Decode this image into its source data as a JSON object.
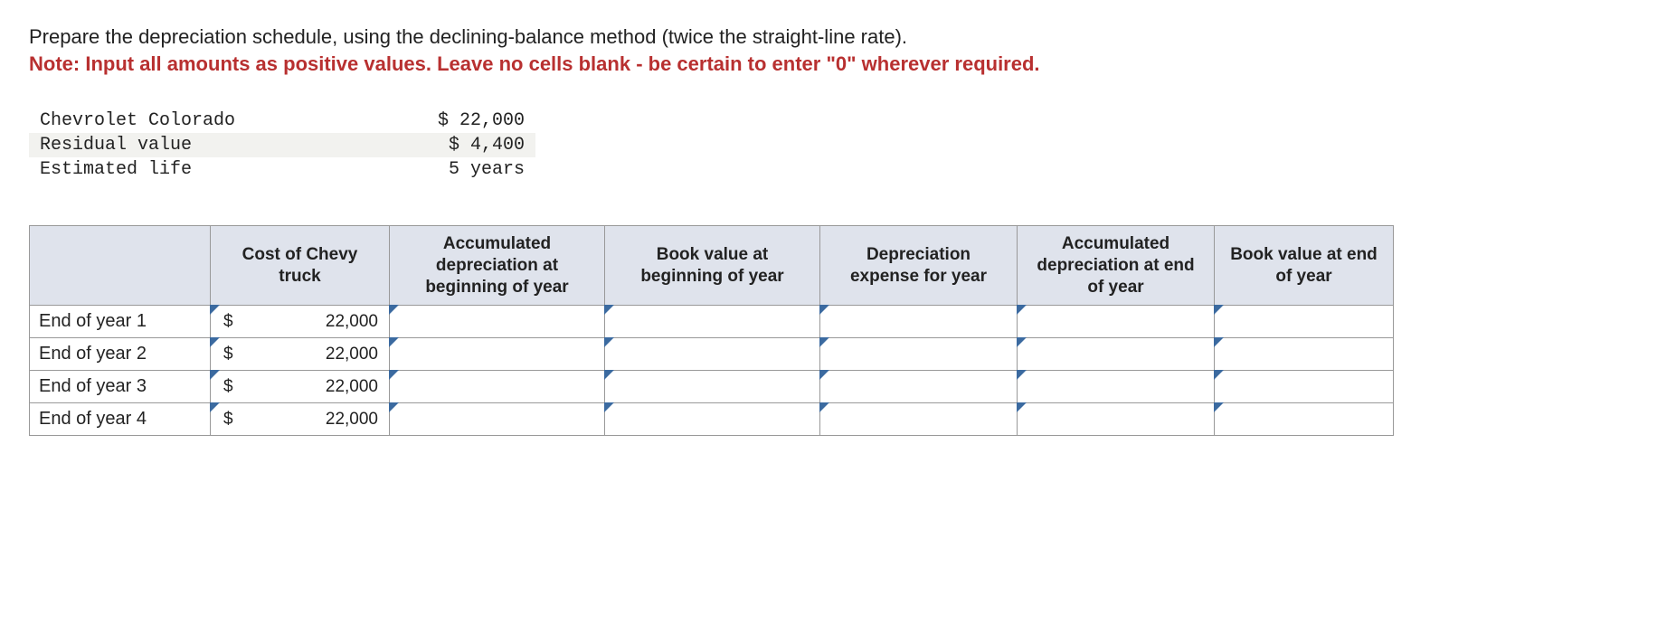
{
  "prompt": {
    "line1": "Prepare the depreciation schedule, using the declining-balance method (twice the straight-line rate).",
    "line2": "Note: Input all amounts as positive values. Leave no cells blank - be certain to enter \"0\" wherever required."
  },
  "given": {
    "asset_label": "Chevrolet Colorado",
    "asset_value": "$ 22,000",
    "residual_label": "Residual value",
    "residual_value": "$ 4,400",
    "life_label": "Estimated life",
    "life_value": "5 years"
  },
  "table": {
    "headers": {
      "blank": "",
      "cost": "Cost of Chevy truck",
      "acc_begin": "Accumulated depreciation at beginning of year",
      "bv_begin": "Book value at beginning of year",
      "dep_exp": "Depreciation expense for year",
      "acc_end": "Accumulated depreciation at end of year",
      "bv_end": "Book value at end of year"
    },
    "rows": [
      {
        "label": "End of year 1",
        "cost_cur": "$",
        "cost_val": "22,000",
        "acc_begin": "",
        "bv_begin": "",
        "dep_exp": "",
        "acc_end": "",
        "bv_end": ""
      },
      {
        "label": "End of year 2",
        "cost_cur": "$",
        "cost_val": "22,000",
        "acc_begin": "",
        "bv_begin": "",
        "dep_exp": "",
        "acc_end": "",
        "bv_end": ""
      },
      {
        "label": "End of year 3",
        "cost_cur": "$",
        "cost_val": "22,000",
        "acc_begin": "",
        "bv_begin": "",
        "dep_exp": "",
        "acc_end": "",
        "bv_end": ""
      },
      {
        "label": "End of year 4",
        "cost_cur": "$",
        "cost_val": "22,000",
        "acc_begin": "",
        "bv_begin": "",
        "dep_exp": "",
        "acc_end": "",
        "bv_end": ""
      }
    ]
  }
}
